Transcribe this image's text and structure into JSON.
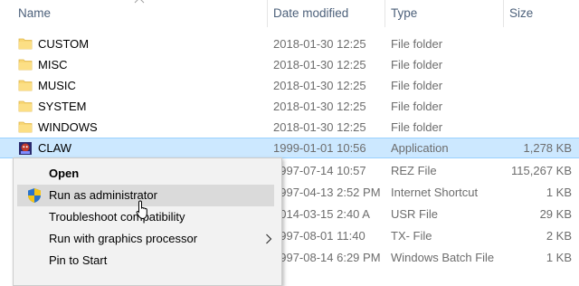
{
  "header": {
    "name": "Name",
    "date_modified": "Date modified",
    "type": "Type",
    "size": "Size"
  },
  "files": [
    {
      "name": "CUSTOM",
      "date": "2018-01-30 12:25",
      "type": "File folder",
      "size": "",
      "icon": "folder-icon"
    },
    {
      "name": "MISC",
      "date": "2018-01-30 12:25",
      "type": "File folder",
      "size": "",
      "icon": "folder-icon"
    },
    {
      "name": "MUSIC",
      "date": "2018-01-30 12:25",
      "type": "File folder",
      "size": "",
      "icon": "folder-icon"
    },
    {
      "name": "SYSTEM",
      "date": "2018-01-30 12:25",
      "type": "File folder",
      "size": "",
      "icon": "folder-icon"
    },
    {
      "name": "WINDOWS",
      "date": "2018-01-30 12:25",
      "type": "File folder",
      "size": "",
      "icon": "folder-icon"
    },
    {
      "name": "CLAW",
      "date": "1999-01-01 10:56",
      "type": "Application",
      "size": "1,278 KB",
      "icon": "claw-app-icon",
      "selected": true
    },
    {
      "name": "",
      "date": "1997-07-14 10:57",
      "type": "REZ File",
      "size": "115,267 KB"
    },
    {
      "name": "",
      "date": "1997-04-13 2:52 PM",
      "type": "Internet Shortcut",
      "size": "1 KB"
    },
    {
      "name": "",
      "date": "2014-03-15 2:40 A",
      "type": "USR File",
      "size": "29 KB"
    },
    {
      "name": "",
      "date": "1997-08-01 11:40",
      "type": "TX- File",
      "size": "2 KB"
    },
    {
      "name": "",
      "date": "1997-08-14 6:29 PM",
      "type": "Windows Batch File",
      "size": "1 KB"
    }
  ],
  "context_menu": {
    "items": [
      {
        "label": "Open",
        "bold": true
      },
      {
        "label": "Run as administrator",
        "icon": "uac-shield-icon",
        "hover": true
      },
      {
        "label": "Troubleshoot compatibility"
      },
      {
        "label": "Run with graphics processor",
        "submenu": true
      },
      {
        "label": "Pin to Start"
      }
    ]
  },
  "colors": {
    "header_text": "#4c607a",
    "selection_bg": "#cce8ff",
    "selection_border": "#99d1ff",
    "folder_yellow": "#f8d775",
    "menu_bg": "#f2f2f2",
    "menu_hover": "#dadada"
  }
}
